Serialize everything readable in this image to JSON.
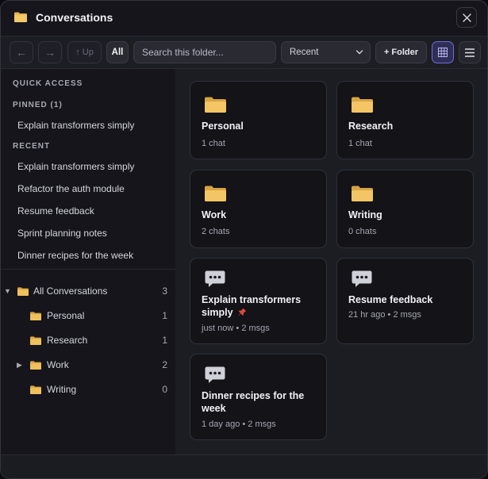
{
  "window": {
    "title": "Conversations"
  },
  "toolbar": {
    "back_label": "←",
    "forward_label": "→",
    "up_label": "↑ Up",
    "all_label": "All",
    "search_placeholder": "Search this folder...",
    "sort_value": "Recent",
    "new_folder_label": "+ Folder"
  },
  "sidebar": {
    "quick_access_heading": "QUICK ACCESS",
    "pinned_heading": "PINNED (1)",
    "pinned": [
      "Explain transformers simply"
    ],
    "recent_heading": "RECENT",
    "recent": [
      "Explain transformers simply",
      "Refactor the auth module",
      "Resume feedback",
      "Sprint planning notes",
      "Dinner recipes for the week"
    ],
    "tree": {
      "root": {
        "label": "All Conversations",
        "count": "3",
        "arrow": "▼"
      },
      "folders": [
        {
          "label": "Personal",
          "count": "1",
          "arrow": ""
        },
        {
          "label": "Research",
          "count": "1",
          "arrow": ""
        },
        {
          "label": "Work",
          "count": "2",
          "arrow": "▶"
        },
        {
          "label": "Writing",
          "count": "0",
          "arrow": ""
        }
      ]
    }
  },
  "main": {
    "folders": [
      {
        "name": "Personal",
        "meta": "1 chat"
      },
      {
        "name": "Research",
        "meta": "1 chat"
      },
      {
        "name": "Work",
        "meta": "2 chats"
      },
      {
        "name": "Writing",
        "meta": "0 chats"
      }
    ],
    "chats": [
      {
        "name": "Explain transformers simply",
        "pinned_icon": "pin-icon",
        "meta": "just now • 2 msgs"
      },
      {
        "name": "Resume feedback",
        "meta": "21 hr ago • 2 msgs"
      },
      {
        "name": "Dinner recipes for the week",
        "meta": "1 day ago • 2 msgs"
      }
    ]
  },
  "colors": {
    "folder": "#e8b552",
    "accent": "#6a6fd8",
    "pin": "#e0483c"
  }
}
